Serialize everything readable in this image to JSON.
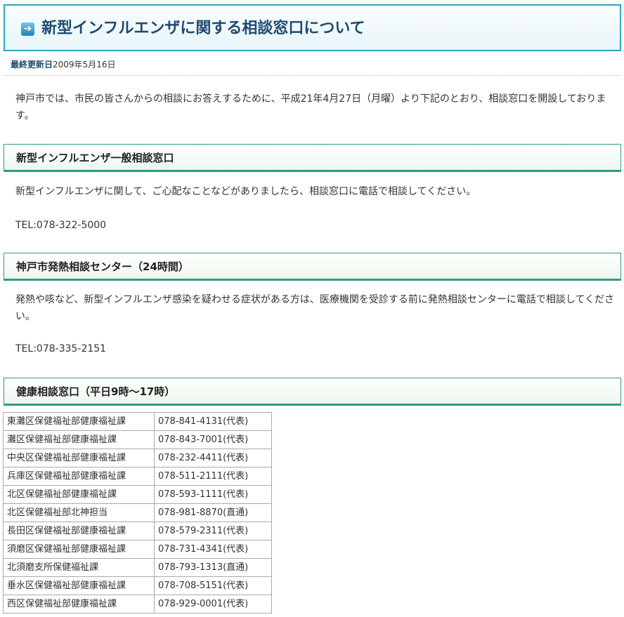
{
  "page": {
    "title": "新型インフルエンザに関する相談窓口について",
    "title_icon": "arrow-right-icon",
    "updated_label": "最終更新日",
    "updated_value": "2009年5月16日",
    "intro": "神戸市では、市民の皆さんからの相談にお答えするために、平成21年4月27日（月曜）より下記のとおり、相談窓口を開設しております。"
  },
  "sections": [
    {
      "heading": "新型インフルエンザ一般相談窓口",
      "text": "新型インフルエンザに関して、ご心配なことなどがありましたら、相談窓口に電話で相談してください。",
      "tel": "TEL:078-322-5000"
    },
    {
      "heading": "神戸市発熱相談センター（24時間）",
      "text": "発熱や咳など、新型インフルエンザ感染を疑わせる症状がある方は、医療機関を受診する前に発熱相談センターに電話で相談してください。",
      "tel": "TEL:078-335-2151"
    },
    {
      "heading": "健康相談窓口（平日9時～17時）"
    }
  ],
  "health_offices": [
    {
      "office": "東灘区保健福祉部健康福祉課",
      "tel": "078-841-4131(代表)"
    },
    {
      "office": "灘区保健福祉部健康福祉課",
      "tel": "078-843-7001(代表)"
    },
    {
      "office": "中央区保健福祉部健康福祉課",
      "tel": "078-232-4411(代表)"
    },
    {
      "office": "兵庫区保健福祉部健康福祉課",
      "tel": "078-511-2111(代表)"
    },
    {
      "office": "北区保健福祉部健康福祉課",
      "tel": "078-593-1111(代表)"
    },
    {
      "office": "北区保健福祉部北神担当",
      "tel": "078-981-8870(直通)"
    },
    {
      "office": "長田区保健福祉部健康福祉課",
      "tel": "078-579-2311(代表)"
    },
    {
      "office": "須磨区保健福祉部健康福祉課",
      "tel": "078-731-4341(代表)"
    },
    {
      "office": "北須磨支所保健福祉課",
      "tel": "078-793-1313(直通)"
    },
    {
      "office": "垂水区保健福祉部健康福祉課",
      "tel": "078-708-5151(代表)"
    },
    {
      "office": "西区保健福祉部健康福祉課",
      "tel": "078-929-0001(代表)"
    }
  ],
  "colors": {
    "title_border": "#2ea7bf",
    "title_text": "#1f4a6e",
    "section_border": "#2e9e7a",
    "table_border": "#aaaaaa"
  }
}
